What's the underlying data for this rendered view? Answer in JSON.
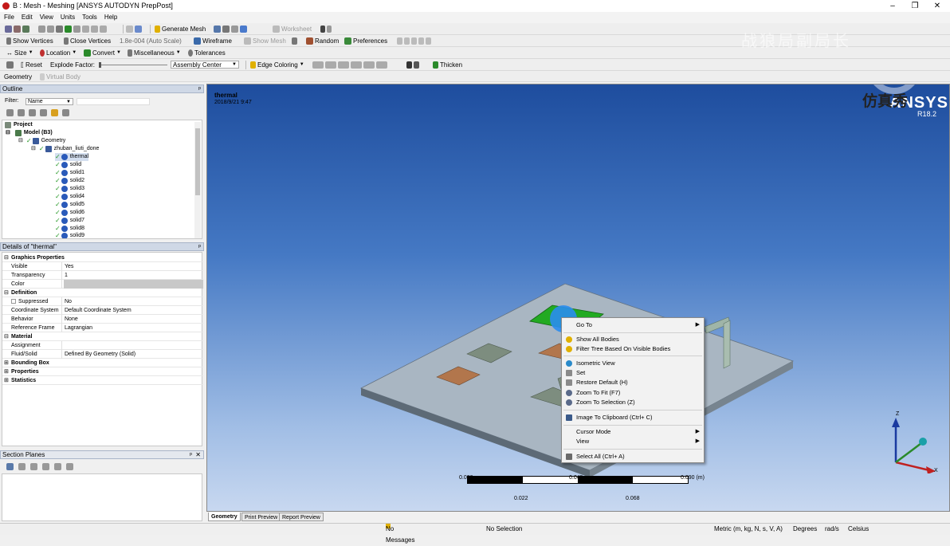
{
  "window": {
    "title": "B : Mesh - Meshing [ANSYS AUTODYN PrepPost]",
    "minimize": "–",
    "restore": "❐",
    "close": "✕"
  },
  "menu": [
    "File",
    "Edit",
    "View",
    "Units",
    "Tools",
    "Help"
  ],
  "toolbar1": {
    "generate_mesh": "Generate Mesh",
    "worksheet": "Worksheet"
  },
  "toolbar2": {
    "show_vertices": "Show Vertices",
    "close_vertices": "Close Vertices",
    "scale_value": "1.8e-004 (Auto Scale)",
    "wireframe": "Wireframe",
    "show_mesh": "Show Mesh",
    "random": "Random",
    "preferences": "Preferences"
  },
  "toolbar3": {
    "size": "Size",
    "location": "Location",
    "convert": "Convert",
    "miscellaneous": "Miscellaneous",
    "tolerances": "Tolerances"
  },
  "toolbar4": {
    "reset": "Reset",
    "explode_factor": "Explode Factor:",
    "assembly_center": "Assembly Center",
    "edge_coloring": "Edge Coloring",
    "thicken": "Thicken"
  },
  "toolbar5": {
    "geometry": "Geometry",
    "virtual_body": "Virtual Body"
  },
  "watermark": {
    "top_text": "战狼局副局长"
  },
  "outline": {
    "header": "Outline",
    "filter_label": "Filter:",
    "filter_value": "Name",
    "tree": {
      "project": "Project",
      "model": "Model (B3)",
      "geometry": "Geometry",
      "part": "zhuban_liuti_done",
      "bodies": [
        "thermal",
        "solid",
        "solid1",
        "solid2",
        "solid3",
        "solid4",
        "solid5",
        "solid6",
        "solid7",
        "solid8",
        "solid9"
      ]
    }
  },
  "details": {
    "header": "Details of \"thermal\"",
    "sections": {
      "graphics_properties": "Graphics Properties",
      "definition": "Definition",
      "material": "Material",
      "bounding_box": "Bounding Box",
      "properties": "Properties",
      "statistics": "Statistics"
    },
    "rows": {
      "visible": {
        "k": "Visible",
        "v": "Yes"
      },
      "transparency": {
        "k": "Transparency",
        "v": "1"
      },
      "color": {
        "k": "Color",
        "v": ""
      },
      "suppressed": {
        "k": "Suppressed",
        "v": "No"
      },
      "coord": {
        "k": "Coordinate System",
        "v": "Default Coordinate System"
      },
      "behavior": {
        "k": "Behavior",
        "v": "None"
      },
      "ref_frame": {
        "k": "Reference Frame",
        "v": "Lagrangian"
      },
      "assignment": {
        "k": "Assignment",
        "v": ""
      },
      "fluid_solid": {
        "k": "Fluid/Solid",
        "v": "Defined By Geometry (Solid)"
      }
    }
  },
  "section_planes": {
    "header": "Section Planes"
  },
  "viewport": {
    "label": "thermal",
    "date": "2018/9/21 9:47",
    "brand": "ANSYS",
    "brand_overlay": "仿真秀",
    "version": "R18.2",
    "scale_labels_top": [
      "0.000",
      "0.045",
      "0.090 (m)"
    ],
    "scale_labels_bottom": [
      "0.022",
      "0.068"
    ],
    "axis_z": "Z",
    "axis_x": "X"
  },
  "context_menu": {
    "go_to": "Go To",
    "show_all": "Show All Bodies",
    "filter_tree": "Filter Tree Based On Visible Bodies",
    "isometric": "Isometric View",
    "set": "Set",
    "restore_default": "Restore Default (H)",
    "zoom_fit": "Zoom To Fit (F7)",
    "zoom_selection": "Zoom To Selection (Z)",
    "image_clipboard": "Image To Clipboard (Ctrl+ C)",
    "cursor_mode": "Cursor Mode",
    "view": "View",
    "select_all": "Select All (Ctrl+ A)"
  },
  "bottom_tabs": [
    "Geometry",
    "Print Preview",
    "Report Preview"
  ],
  "status": {
    "messages": "No Messages",
    "selection": "No Selection",
    "units": "Metric (m, kg, N, s, V, A)",
    "degrees": "Degrees",
    "rads": "rad/s",
    "celsius": "Celsius"
  },
  "colors": {
    "accent_header": "#cfd8e6",
    "viewport_top": "#1e4d9e",
    "viewport_bottom": "#c8d8f0",
    "selected_body": "#22aa22"
  }
}
